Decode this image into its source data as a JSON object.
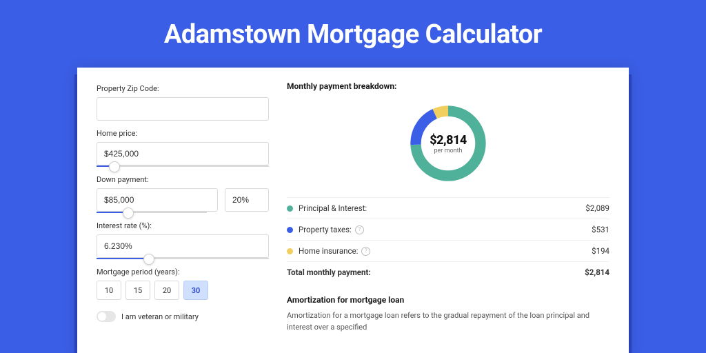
{
  "title": "Adamstown Mortgage Calculator",
  "form": {
    "zip_label": "Property Zip Code:",
    "zip_value": "",
    "home_price_label": "Home price:",
    "home_price_value": "$425,000",
    "down_payment_label": "Down payment:",
    "down_payment_value": "$85,000",
    "down_payment_pct": "20%",
    "interest_label": "Interest rate (%):",
    "interest_value": "6.230%",
    "period_label": "Mortgage period (years):",
    "periods": [
      "10",
      "15",
      "20",
      "30"
    ],
    "period_active": "30",
    "veteran_label": "I am veteran or military"
  },
  "breakdown": {
    "title": "Monthly payment breakdown:",
    "total_amount": "$2,814",
    "total_sub": "per month",
    "items": [
      {
        "label": "Principal & Interest:",
        "value": "$2,089",
        "color": "#4fb199",
        "info": false
      },
      {
        "label": "Property taxes:",
        "value": "$531",
        "color": "#3b5ee6",
        "info": true
      },
      {
        "label": "Home insurance:",
        "value": "$194",
        "color": "#f1cf5e",
        "info": true
      }
    ],
    "total_label": "Total monthly payment:",
    "total_value": "$2,814"
  },
  "amort": {
    "title": "Amortization for mortgage loan",
    "body": "Amortization for a mortgage loan refers to the gradual repayment of the loan principal and interest over a specified"
  },
  "chart_data": {
    "type": "pie",
    "title": "Monthly payment breakdown",
    "categories": [
      "Principal & Interest",
      "Property taxes",
      "Home insurance"
    ],
    "values": [
      2089,
      531,
      194
    ],
    "colors": [
      "#4fb199",
      "#3b5ee6",
      "#f1cf5e"
    ],
    "total": 2814
  }
}
